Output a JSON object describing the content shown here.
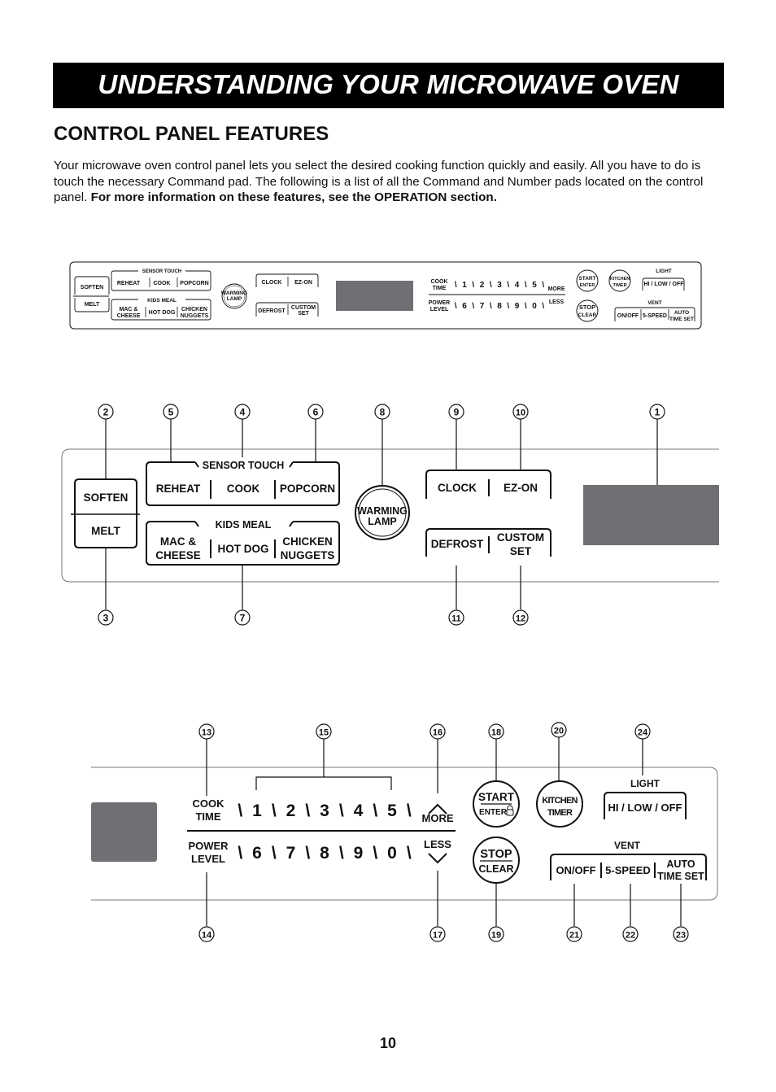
{
  "header": {
    "title": "UNDERSTANDING YOUR MICROWAVE OVEN"
  },
  "section": {
    "title": "CONTROL PANEL FEATURES",
    "intro_regular": "Your microwave oven control panel lets you select the desired cooking function quickly and easily. All you have to do is touch the necessary Command pad. The following is a list of all the Command and Number pads located on the control panel. ",
    "intro_bold": "For more information on these features, see the OPERATION section."
  },
  "panel": {
    "soften": "SOFTEN",
    "melt": "MELT",
    "sensor_touch": "SENSOR TOUCH",
    "reheat": "REHEAT",
    "cook": "COOK",
    "popcorn": "POPCORN",
    "kids_meal": "KIDS MEAL",
    "mac_cheese_1": "MAC &",
    "mac_cheese_2": "CHEESE",
    "hot_dog": "HOT DOG",
    "chicken_nuggets_1": "CHICKEN",
    "chicken_nuggets_2": "NUGGETS",
    "warming_lamp_1": "WARMING",
    "warming_lamp_2": "LAMP",
    "clock": "CLOCK",
    "ez_on": "EZ-ON",
    "defrost": "DEFROST",
    "custom_set_1": "CUSTOM",
    "custom_set_2": "SET",
    "cook_time_1": "COOK",
    "cook_time_2": "TIME",
    "power_level_1": "POWER",
    "power_level_2": "LEVEL",
    "digits_top": [
      "1",
      "2",
      "3",
      "4",
      "5"
    ],
    "digits_bottom": [
      "6",
      "7",
      "8",
      "9",
      "0"
    ],
    "more": "MORE",
    "less": "LESS",
    "start": "START",
    "enter": "ENTER",
    "stop": "STOP",
    "clear": "CLEAR",
    "kitchen_timer_1": "KITCHEN",
    "kitchen_timer_2": "TIMER",
    "light": "LIGHT",
    "hi_low_off": "HI / LOW / OFF",
    "vent": "VENT",
    "on_off": "ON/OFF",
    "five_speed": "5-SPEED",
    "auto_time_set_1": "AUTO",
    "auto_time_set_2": "TIME SET"
  },
  "callouts": [
    "1",
    "2",
    "3",
    "4",
    "5",
    "6",
    "7",
    "8",
    "9",
    "10",
    "11",
    "12",
    "13",
    "14",
    "15",
    "16",
    "17",
    "18",
    "19",
    "20",
    "21",
    "22",
    "23",
    "24"
  ],
  "colors": {
    "display": "#6f7073",
    "ink": "#111111"
  },
  "footer": {
    "page_number": "10"
  }
}
